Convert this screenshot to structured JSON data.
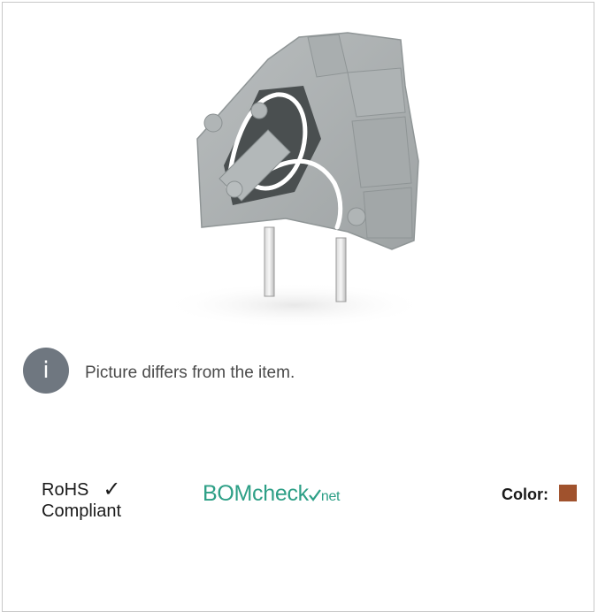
{
  "notice": {
    "icon": "info-icon",
    "icon_glyph": "i",
    "text": "Picture differs from the item."
  },
  "compliance": {
    "rohs_line1": "RoHS",
    "rohs_check": "✓",
    "rohs_line2": "Compliant",
    "bomcheck_main": "BOMcheck",
    "bomcheck_suffix": "net"
  },
  "color": {
    "label": "Color:",
    "swatch_hex": "#a0522d"
  },
  "product": {
    "image_icon": "terminal-block-image"
  }
}
